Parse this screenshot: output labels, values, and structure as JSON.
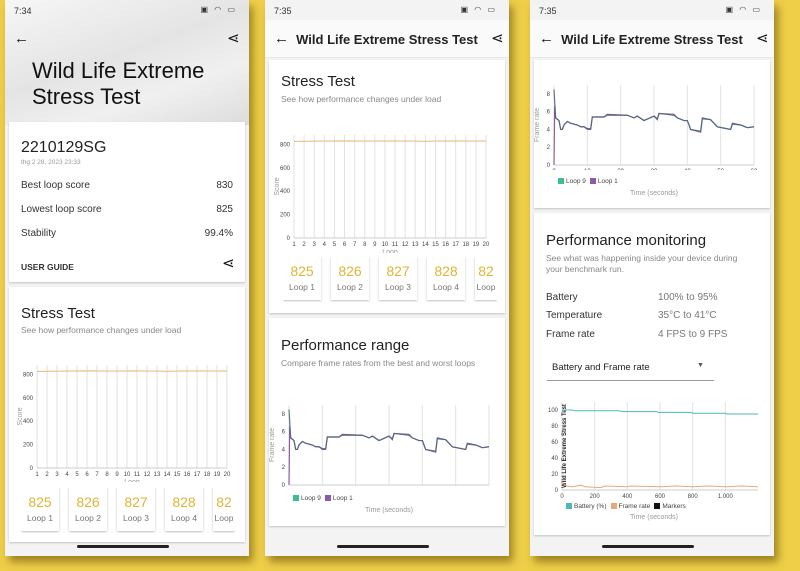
{
  "colors": {
    "background": "#efcf48",
    "score_accent": "#e0b535",
    "loop9": "#3bbf8f",
    "loop1": "#8c5aa8",
    "battery": "#4fb8b4",
    "frame_rate": "#e8a878",
    "markers": "#111111",
    "stress_line": "#e9c08a"
  },
  "phones": [
    {
      "status_time": "7:34",
      "hero_title_line1": "Wild Life Extreme",
      "hero_title_line2": "Stress Test",
      "device": "2210129SG",
      "date": "thg 2 28, 2023 23:33",
      "stats": [
        {
          "label": "Best loop score",
          "value": "830"
        },
        {
          "label": "Lowest loop score",
          "value": "825"
        },
        {
          "label": "Stability",
          "value": "99.4%"
        }
      ],
      "user_guide": "USER GUIDE"
    },
    {
      "status_time": "7:35",
      "title": "Wild Life Extreme Stress Test"
    },
    {
      "status_time": "7:35",
      "title": "Wild Life Extreme Stress Test"
    }
  ],
  "stress_test": {
    "title": "Stress Test",
    "subtitle": "See how performance changes under load",
    "loops": [
      {
        "score": "825",
        "label": "Loop 1"
      },
      {
        "score": "826",
        "label": "Loop 2"
      },
      {
        "score": "827",
        "label": "Loop 3"
      },
      {
        "score": "828",
        "label": "Loop 4"
      },
      {
        "score": "82",
        "label": "Loop"
      }
    ]
  },
  "performance_range": {
    "title": "Performance range",
    "subtitle": "Compare frame rates from the best and worst loops"
  },
  "performance_monitoring": {
    "title": "Performance monitoring",
    "subtitle": "See what was happening inside your device during your benchmark run.",
    "rows": [
      {
        "label": "Battery",
        "value": "100% to 95%"
      },
      {
        "label": "Temperature",
        "value": "35°C to 41°C"
      },
      {
        "label": "Frame rate",
        "value": "4 FPS to 9 FPS"
      }
    ],
    "dropdown_value": "Battery and Frame rate"
  },
  "chart_data": [
    {
      "type": "line",
      "xlabel": "Loop",
      "ylabel": "Score",
      "ylim": [
        0,
        880
      ],
      "yticks": [
        0,
        200,
        400,
        600,
        800
      ],
      "x": [
        1,
        2,
        3,
        4,
        5,
        6,
        7,
        8,
        9,
        10,
        11,
        12,
        13,
        14,
        15,
        16,
        17,
        18,
        19,
        20
      ],
      "series": [
        {
          "values": [
            825,
            826,
            827,
            828,
            829,
            830,
            829,
            828,
            828,
            829,
            829,
            828,
            828,
            825,
            828,
            829,
            829,
            828,
            828,
            829
          ]
        }
      ],
      "grid": "vertical"
    },
    {
      "type": "line",
      "xlabel": "Time (seconds)",
      "ylabel": "Frame rate",
      "xlim": [
        0,
        60
      ],
      "ylim": [
        0,
        9
      ],
      "xticks": [
        0,
        10,
        20,
        30,
        40,
        50,
        60
      ],
      "yticks": [
        0,
        2,
        4,
        6,
        8
      ],
      "legend": "bottom-left",
      "grid": "vertical",
      "series": [
        {
          "name": "Loop 1",
          "points": [
            [
              0,
              0
            ],
            [
              0.2,
              6.6
            ],
            [
              0.5,
              5.3
            ],
            [
              1.5,
              5
            ],
            [
              2,
              4
            ],
            [
              2.5,
              4
            ],
            [
              3,
              4.5
            ],
            [
              4,
              4.9
            ],
            [
              5,
              4.7
            ],
            [
              7,
              4.5
            ],
            [
              8,
              4.3
            ],
            [
              9,
              4.3
            ],
            [
              10,
              4
            ],
            [
              11,
              4
            ],
            [
              11.5,
              5.4
            ],
            [
              15,
              5.4
            ],
            [
              16,
              5.6
            ],
            [
              22,
              5.6
            ],
            [
              24,
              5.3
            ],
            [
              25,
              5.5
            ],
            [
              27,
              5
            ],
            [
              30,
              5.5
            ],
            [
              31,
              5.1
            ],
            [
              31.5,
              5.8
            ],
            [
              36,
              5.6
            ],
            [
              37,
              5.3
            ],
            [
              39,
              5
            ],
            [
              40,
              5
            ],
            [
              41,
              4
            ],
            [
              44,
              3.7
            ],
            [
              44.5,
              5.2
            ],
            [
              47,
              5.1
            ],
            [
              49,
              4.3
            ],
            [
              53,
              4
            ],
            [
              53.5,
              4.6
            ],
            [
              56,
              4.5
            ],
            [
              58,
              4.2
            ],
            [
              60,
              4.3
            ]
          ]
        },
        {
          "name": "Loop 9",
          "points": [
            [
              0,
              8.5
            ],
            [
              0.5,
              5.3
            ],
            [
              1.5,
              5
            ],
            [
              2,
              4
            ],
            [
              2.5,
              4
            ],
            [
              3,
              4.5
            ],
            [
              4,
              4.9
            ],
            [
              5,
              4.7
            ],
            [
              7,
              4.5
            ],
            [
              8,
              4.3
            ],
            [
              9,
              4.3
            ],
            [
              10,
              4.1
            ],
            [
              11,
              4.1
            ],
            [
              11.5,
              5.4
            ],
            [
              15,
              5.4
            ],
            [
              16,
              5.7
            ],
            [
              22,
              5.6
            ],
            [
              24,
              5.3
            ],
            [
              25,
              5.5
            ],
            [
              27,
              5
            ],
            [
              30,
              5.5
            ],
            [
              31,
              5.2
            ],
            [
              31.5,
              5.8
            ],
            [
              36,
              5.7
            ],
            [
              37,
              5.3
            ],
            [
              39,
              5
            ],
            [
              40,
              5
            ],
            [
              41,
              4
            ],
            [
              44,
              3.8
            ],
            [
              44.5,
              5.3
            ],
            [
              47,
              5.1
            ],
            [
              49,
              4.3
            ],
            [
              53,
              4
            ],
            [
              53.5,
              4.7
            ],
            [
              56,
              4.5
            ],
            [
              58,
              4.2
            ],
            [
              60,
              4.3
            ]
          ]
        }
      ]
    },
    {
      "type": "line",
      "xlabel": "Time (seconds)",
      "ylabel": "Wild Life Extreme Stress Test",
      "xlim": [
        0,
        1200
      ],
      "ylim": [
        0,
        110
      ],
      "xticks": [
        0,
        200,
        400,
        600,
        800,
        1000
      ],
      "xtick_labels": [
        "0",
        "200",
        "400",
        "600",
        "800",
        "1.000"
      ],
      "yticks": [
        0,
        20,
        40,
        60,
        80,
        100
      ],
      "legend": "bottom-left",
      "grid": "vertical",
      "series": [
        {
          "name": "Battery (%)",
          "points": [
            [
              0,
              100
            ],
            [
              60,
              100
            ],
            [
              80,
              99
            ],
            [
              350,
              99
            ],
            [
              370,
              98
            ],
            [
              580,
              98
            ],
            [
              590,
              97
            ],
            [
              790,
              97
            ],
            [
              800,
              96
            ],
            [
              1000,
              96
            ],
            [
              1010,
              95
            ],
            [
              1200,
              95
            ]
          ]
        },
        {
          "name": "Frame rate",
          "points": [
            [
              0,
              9
            ],
            [
              30,
              5
            ],
            [
              60,
              4
            ],
            [
              120,
              6
            ],
            [
              140,
              4
            ],
            [
              240,
              3
            ],
            [
              260,
              5
            ],
            [
              400,
              4
            ],
            [
              420,
              5
            ],
            [
              600,
              4
            ],
            [
              700,
              5
            ],
            [
              800,
              4
            ],
            [
              900,
              5
            ],
            [
              1000,
              4
            ],
            [
              1100,
              5
            ],
            [
              1200,
              4
            ]
          ]
        },
        {
          "name": "Markers",
          "points": []
        }
      ]
    }
  ]
}
